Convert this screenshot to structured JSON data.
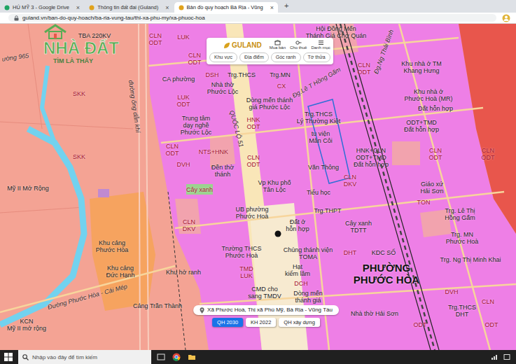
{
  "browser": {
    "tabs": [
      {
        "label": "HÚ MỸ 3 - Google Drive",
        "selected": false
      },
      {
        "label": "Thông tin đất đai (Guland)",
        "selected": false
      },
      {
        "label": "Bản đồ quy hoạch Bà Rịa - Vũng",
        "selected": true
      }
    ],
    "close_glyph": "×",
    "new_tab": "+",
    "url": "guland.vn/ban-do-quy-hoach/ba-ria-vung-tau/thi-xa-phu-my/xa-phuoc-hoa"
  },
  "watermark": {
    "brand": "NHÀ ĐẤT",
    "slogan": "TÌM LÀ THẤY"
  },
  "guland": {
    "logo": "GULAND",
    "nav": [
      "Mua bán",
      "Cho thuê",
      "Danh mục"
    ],
    "filters": [
      "Khu vực",
      "Địa điểm",
      "Góc ranh",
      "Tờ thửa"
    ]
  },
  "map": {
    "labels": [
      {
        "text": "TBA 220KV",
        "kind": "place"
      },
      {
        "text": "CLN\nODT",
        "kind": "zone"
      },
      {
        "text": "LUK",
        "kind": "zone"
      },
      {
        "text": "CLN\nODT",
        "kind": "zone"
      },
      {
        "text": "ường 965",
        "kind": "road"
      },
      {
        "text": "SKK",
        "kind": "zone"
      },
      {
        "text": "SKK",
        "kind": "zone"
      },
      {
        "text": "đường ống dẫn khí",
        "kind": "road"
      },
      {
        "text": "Hội Đồng Mến\nThánh Giá Chợ Quán",
        "kind": "place"
      },
      {
        "text": "DSH",
        "kind": "zone"
      },
      {
        "text": "Trg.THCS",
        "kind": "place"
      },
      {
        "text": "Trg.MN",
        "kind": "place"
      },
      {
        "text": "Nhà thờ\nPhước Lộc",
        "kind": "place"
      },
      {
        "text": "CX",
        "kind": "zone"
      },
      {
        "text": "Đg.Lê T Hồng Gấm",
        "kind": "road"
      },
      {
        "text": "CA phường",
        "kind": "place"
      },
      {
        "text": "LUK\nODT",
        "kind": "zone"
      },
      {
        "text": "Dòng mến thánh\ngiá Phước Lộc",
        "kind": "place"
      },
      {
        "text": "Trung tâm\ndạy nghề\nPhước Lộc",
        "kind": "place"
      },
      {
        "text": "QUỐC LỘ 51",
        "kind": "road"
      },
      {
        "text": "HNK\nODT",
        "kind": "zone"
      },
      {
        "text": "Trg.THCS\nLý Thường Kiệt",
        "kind": "place"
      },
      {
        "text": "tu viện\nMân Côi",
        "kind": "place"
      },
      {
        "text": "Đg.Ng Thái Bình",
        "kind": "road"
      },
      {
        "text": "CLN\nODT",
        "kind": "zone"
      },
      {
        "text": "Khu nhà ở TM\nKhang Hưng",
        "kind": "place"
      },
      {
        "text": "Khu nhà ở\nPhước Hoà (MR)",
        "kind": "place"
      },
      {
        "text": "Đất hỗn hợp",
        "kind": "place"
      },
      {
        "text": "ODT+TMD\nĐất hỗn hợp",
        "kind": "place"
      },
      {
        "text": "HNK+CLN\nODT+TMD\nĐất hỗn hợp",
        "kind": "place"
      },
      {
        "text": "CLN\nODT",
        "kind": "zone"
      },
      {
        "text": "CLN\nODT",
        "kind": "zone"
      },
      {
        "text": "NTS+HNK",
        "kind": "zone"
      },
      {
        "text": "CLN\nODT",
        "kind": "zone"
      },
      {
        "text": "DVH",
        "kind": "zone"
      },
      {
        "text": "CLN\nODT",
        "kind": "zone"
      },
      {
        "text": "Đền thờ\nthánh",
        "kind": "place"
      },
      {
        "text": "Cây xanh",
        "kind": "zone"
      },
      {
        "text": "Vp Khu phố\nTân Lộc",
        "kind": "place"
      },
      {
        "text": "Văn Thông",
        "kind": "place"
      },
      {
        "text": "CLN\nDKV",
        "kind": "zone"
      },
      {
        "text": "Tiểu học",
        "kind": "place"
      },
      {
        "text": "Giáo xứ\nHải Sơn",
        "kind": "place"
      },
      {
        "text": "TON",
        "kind": "zone"
      },
      {
        "text": "Trg. Lê Thị\nHồng Gấm",
        "kind": "place"
      },
      {
        "text": "UB phường\nPhước Hoà",
        "kind": "place"
      },
      {
        "text": "Trg.THPT",
        "kind": "place"
      },
      {
        "text": "Đất ở\nhỗn hợp",
        "kind": "place"
      },
      {
        "text": "Cây xanh\nTDTT",
        "kind": "place"
      },
      {
        "text": "CLN\nDKV",
        "kind": "zone"
      },
      {
        "text": "Mỹ II Mở Rộng",
        "kind": "place"
      },
      {
        "text": "Khu cảng\nPhước Hòa",
        "kind": "place"
      },
      {
        "text": "Trường THCS\nPhước Hoà",
        "kind": "place"
      },
      {
        "text": "Chủng thánh viện\nTOMA",
        "kind": "place"
      },
      {
        "text": "DHT",
        "kind": "zone"
      },
      {
        "text": "KDC SỐ",
        "kind": "place"
      },
      {
        "text": "Trg. MN\nPhước Hoà",
        "kind": "place"
      },
      {
        "text": "Trg. Ng Thị Minh Khai",
        "kind": "place"
      },
      {
        "text": "PHƯỜNG\nPHƯỚC HÒA",
        "kind": "district"
      },
      {
        "text": "Khu cảng\nĐức Hạnh",
        "kind": "place"
      },
      {
        "text": "Khu hở ranh",
        "kind": "place"
      },
      {
        "text": "TMD\nLUK",
        "kind": "zone"
      },
      {
        "text": "Hạt\nkiểm lâm",
        "kind": "place"
      },
      {
        "text": "DCH",
        "kind": "zone"
      },
      {
        "text": "CMD cho\nsang TMDV",
        "kind": "place"
      },
      {
        "text": "Dòng mến\nthánh giá",
        "kind": "place"
      },
      {
        "text": "Đường Phước Hòa - Cái Mép",
        "kind": "road"
      },
      {
        "text": "Cảng Trần Thành",
        "kind": "place"
      },
      {
        "text": "KCN\nMỹ II mở rộng",
        "kind": "place"
      },
      {
        "text": "Nhà thờ Hải Sơn",
        "kind": "place"
      },
      {
        "text": "DVH",
        "kind": "zone"
      },
      {
        "text": "CLN",
        "kind": "zone"
      },
      {
        "text": "Trg.THCS\nDHT",
        "kind": "place"
      },
      {
        "text": "ODT",
        "kind": "zone"
      },
      {
        "text": "ODT",
        "kind": "zone"
      }
    ]
  },
  "location": "Xã Phước Hoà, Thị xã Phú Mỹ, Bà Rịa - Vũng Tàu",
  "layers": [
    {
      "label": "QH 2030",
      "selected": true
    },
    {
      "label": "KH 2022",
      "selected": false
    },
    {
      "label": "QH xây dựng",
      "selected": false
    }
  ],
  "taskbar": {
    "search_placeholder": "Nhập vào đây để tìm kiếm"
  }
}
